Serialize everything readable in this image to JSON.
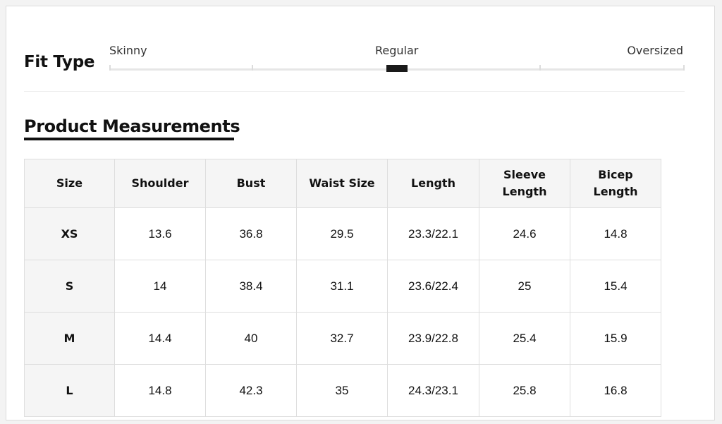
{
  "fit": {
    "title": "Fit Type",
    "options": [
      "Skinny",
      "Regular",
      "Oversized"
    ],
    "selected": "Regular",
    "selected_fraction": 0.5
  },
  "measurements": {
    "title": "Product Measurements",
    "headers": [
      "Size",
      "Shoulder",
      "Bust",
      "Waist Size",
      "Length",
      "Sleeve Length",
      "Bicep Length"
    ],
    "rows": [
      [
        "XS",
        "13.6",
        "36.8",
        "29.5",
        "23.3/22.1",
        "24.6",
        "14.8"
      ],
      [
        "S",
        "14",
        "38.4",
        "31.1",
        "23.6/22.4",
        "25",
        "15.4"
      ],
      [
        "M",
        "14.4",
        "40",
        "32.7",
        "23.9/22.8",
        "25.4",
        "15.9"
      ],
      [
        "L",
        "14.8",
        "42.3",
        "35",
        "24.3/23.1",
        "25.8",
        "16.8"
      ]
    ]
  }
}
